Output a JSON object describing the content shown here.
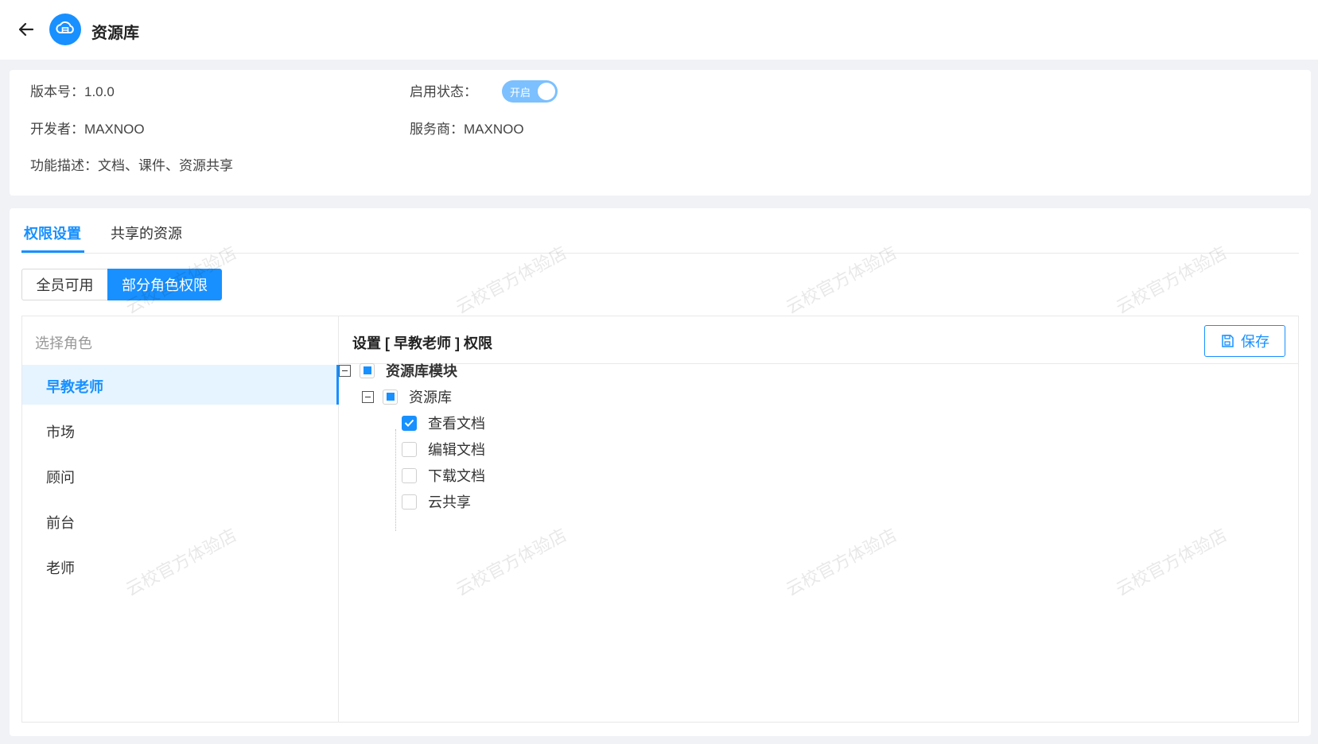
{
  "header": {
    "title": "资源库"
  },
  "info": {
    "version_label": "版本号：1.0.0",
    "status_label": "启用状态：",
    "status_toggle_text": "开启",
    "developer_label": "开发者：MAXNOO",
    "provider_label": "服务商：MAXNOO",
    "description_label": "功能描述：文档、课件、资源共享"
  },
  "tabs": [
    {
      "label": "权限设置",
      "active": true
    },
    {
      "label": "共享的资源",
      "active": false
    }
  ],
  "segments": {
    "all": "全员可用",
    "partial": "部分角色权限",
    "selected": "部分角色权限"
  },
  "roles": {
    "heading": "选择角色",
    "items": [
      {
        "label": "早教老师",
        "active": true
      },
      {
        "label": "市场",
        "active": false
      },
      {
        "label": "顾问",
        "active": false
      },
      {
        "label": "前台",
        "active": false
      },
      {
        "label": "老师",
        "active": false
      }
    ]
  },
  "permissions": {
    "title": "设置 [ 早教老师 ] 权限",
    "save_label": "保存",
    "tree": {
      "module": {
        "label": "资源库模块",
        "state": "partial"
      },
      "group": {
        "label": "资源库",
        "state": "partial"
      },
      "items": [
        {
          "label": "查看文档",
          "checked": true
        },
        {
          "label": "编辑文档",
          "checked": false
        },
        {
          "label": "下载文档",
          "checked": false
        },
        {
          "label": "云共享",
          "checked": false
        }
      ]
    }
  },
  "watermark": "云校官方体验店",
  "colors": {
    "accent": "#1890ff",
    "accent_light": "#e6f4ff",
    "toggle_on": "#7cc0ff"
  }
}
